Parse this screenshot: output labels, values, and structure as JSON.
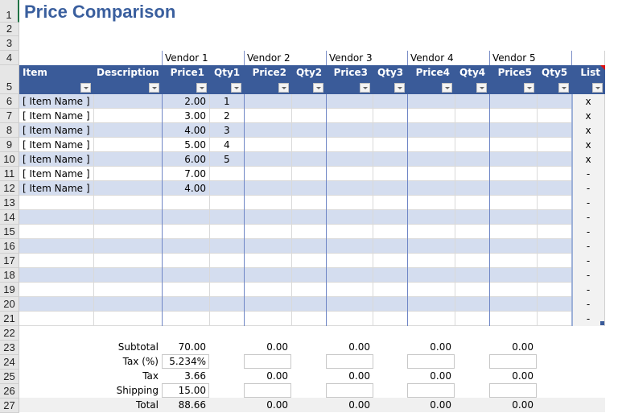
{
  "title": "Price Comparison",
  "row_numbers": [
    "1",
    "2",
    "3",
    "4",
    "5",
    "6",
    "7",
    "8",
    "9",
    "10",
    "11",
    "12",
    "13",
    "14",
    "15",
    "16",
    "17",
    "18",
    "19",
    "20",
    "21",
    "22",
    "23",
    "24",
    "25",
    "26",
    "27"
  ],
  "vendors": [
    "Vendor 1",
    "Vendor 2",
    "Vendor 3",
    "Vendor 4",
    "Vendor 5"
  ],
  "headers": {
    "item": "Item",
    "description": "Description",
    "price1": "Price1",
    "qty1": "Qty1",
    "price2": "Price2",
    "qty2": "Qty2",
    "price3": "Price3",
    "qty3": "Qty3",
    "price4": "Price4",
    "qty4": "Qty4",
    "price5": "Price5",
    "qty5": "Qty5",
    "list": "List"
  },
  "rows": [
    {
      "item": "[ Item Name ]",
      "price1": "2.00",
      "qty1": "1",
      "list": "x"
    },
    {
      "item": "[ Item Name ]",
      "price1": "3.00",
      "qty1": "2",
      "list": "x"
    },
    {
      "item": "[ Item Name ]",
      "price1": "4.00",
      "qty1": "3",
      "list": "x"
    },
    {
      "item": "[ Item Name ]",
      "price1": "5.00",
      "qty1": "4",
      "list": "x"
    },
    {
      "item": "[ Item Name ]",
      "price1": "6.00",
      "qty1": "5",
      "list": "x"
    },
    {
      "item": "[ Item Name ]",
      "price1": "7.00",
      "qty1": "",
      "list": "-"
    },
    {
      "item": "[ Item Name ]",
      "price1": "4.00",
      "qty1": "",
      "list": "-"
    },
    {
      "item": "",
      "price1": "",
      "qty1": "",
      "list": "-"
    },
    {
      "item": "",
      "price1": "",
      "qty1": "",
      "list": "-"
    },
    {
      "item": "",
      "price1": "",
      "qty1": "",
      "list": "-"
    },
    {
      "item": "",
      "price1": "",
      "qty1": "",
      "list": "-"
    },
    {
      "item": "",
      "price1": "",
      "qty1": "",
      "list": "-"
    },
    {
      "item": "",
      "price1": "",
      "qty1": "",
      "list": "-"
    },
    {
      "item": "",
      "price1": "",
      "qty1": "",
      "list": "-"
    },
    {
      "item": "",
      "price1": "",
      "qty1": "",
      "list": "-"
    },
    {
      "item": "",
      "price1": "",
      "qty1": "",
      "list": "-"
    }
  ],
  "summary": {
    "labels": {
      "subtotal": "Subtotal",
      "tax_pct": "Tax (%)",
      "tax": "Tax",
      "shipping": "Shipping",
      "total": "Total"
    },
    "vendor1": {
      "subtotal": "70.00",
      "tax_pct": "5.234%",
      "tax": "3.66",
      "shipping": "15.00",
      "total": "88.66"
    },
    "vendor2": {
      "subtotal": "0.00",
      "tax_pct": "",
      "tax": "0.00",
      "shipping": "",
      "total": "0.00"
    },
    "vendor3": {
      "subtotal": "0.00",
      "tax_pct": "",
      "tax": "0.00",
      "shipping": "",
      "total": "0.00"
    },
    "vendor4": {
      "subtotal": "0.00",
      "tax_pct": "",
      "tax": "0.00",
      "shipping": "",
      "total": "0.00"
    },
    "vendor5": {
      "subtotal": "0.00",
      "tax_pct": "",
      "tax": "0.00",
      "shipping": "",
      "total": "0.00"
    }
  },
  "colors": {
    "header_bg": "#3a5b99",
    "band": "#d4ddef",
    "title": "#3a5f9e"
  }
}
